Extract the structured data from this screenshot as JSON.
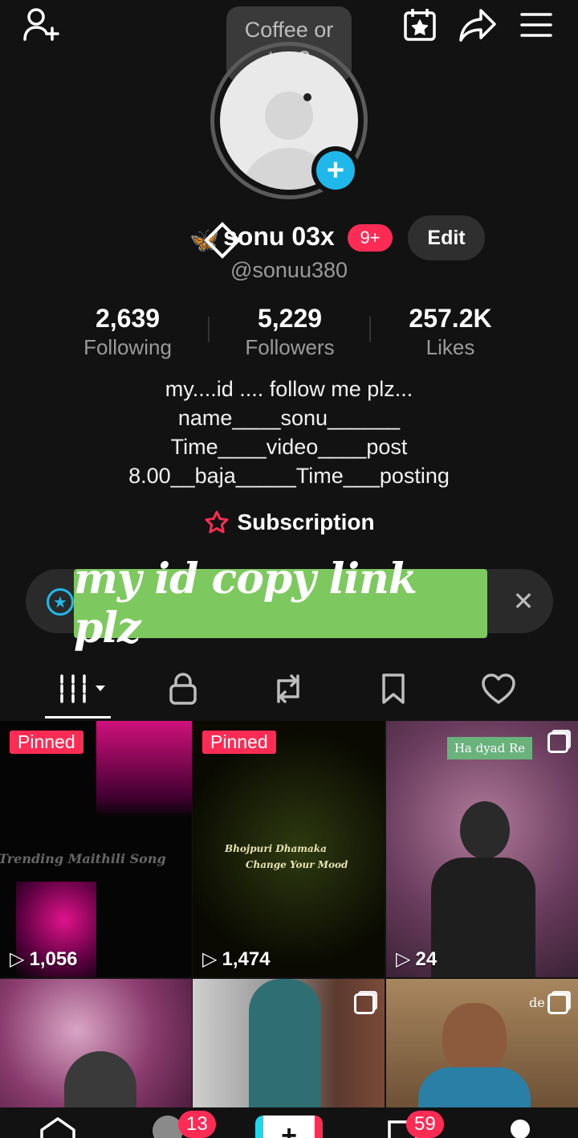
{
  "tooltip": {
    "line1": "Coffee or",
    "line2": "tea?"
  },
  "profile": {
    "emoji": "🦋",
    "name": "sonu 03x",
    "badge": "9+",
    "edit_label": "Edit",
    "username": "@sonuu380"
  },
  "stats": [
    {
      "value": "2,639",
      "label": "Following"
    },
    {
      "value": "5,229",
      "label": "Followers"
    },
    {
      "value": "257.2K",
      "label": "Likes"
    }
  ],
  "bio": {
    "line1": "my....id .... follow me plz...",
    "line2": "name____sonu______",
    "line3": "Time____video____post",
    "line4": "8.00__baja_____Time___posting"
  },
  "subscription_label": "Subscription",
  "promo": {
    "text": "my id copy link plz"
  },
  "tabs": [
    "videos-tab",
    "private-tab",
    "reposts-tab",
    "favorites-tab",
    "liked-tab"
  ],
  "videos": [
    {
      "pinned": "Pinned",
      "views": "1,056",
      "caption": "Trending Maithili Song"
    },
    {
      "pinned": "Pinned",
      "views": "1,474",
      "caption1": "Bhojpuri Dhamaka",
      "caption2": "Change Your Mood"
    },
    {
      "views": "24",
      "caption": "Ha dyad Re"
    },
    {
      "views": ""
    },
    {
      "views": ""
    },
    {
      "views": "",
      "caption": "de"
    }
  ],
  "bottom_nav": {
    "inbox_badge": "13",
    "messages_badge": "59"
  },
  "colors": {
    "accent": "#fe2c55",
    "cyan": "#20b8ea",
    "promo_green": "#7dc85f",
    "background": "#121212"
  }
}
